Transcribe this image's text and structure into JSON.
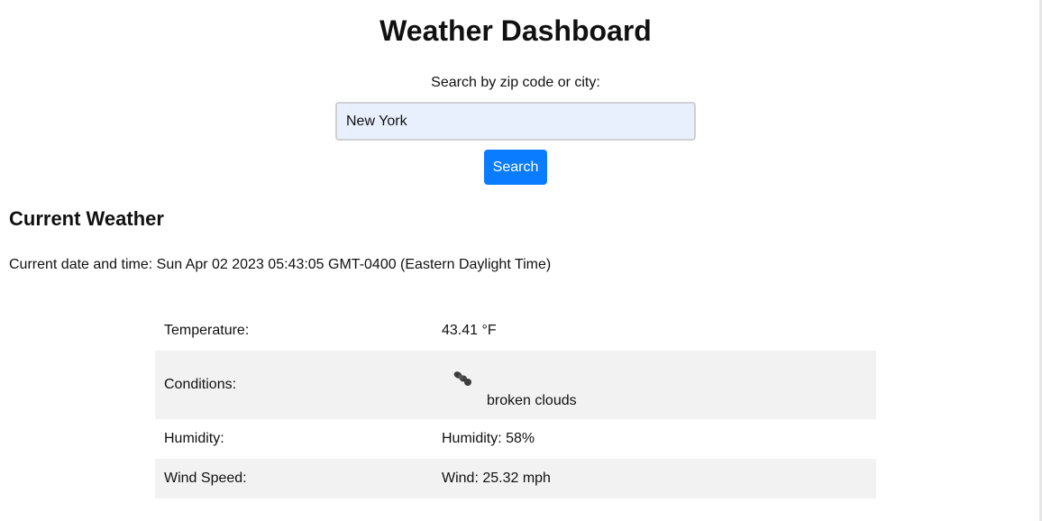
{
  "header": {
    "title": "Weather Dashboard"
  },
  "search": {
    "label": "Search by zip code or city:",
    "value": "New York",
    "button_label": "Search"
  },
  "current": {
    "heading": "Current Weather",
    "datetime": "Current date and time: Sun Apr 02 2023 05:43:05 GMT-0400 (Eastern Daylight Time)"
  },
  "weather": {
    "rows": [
      {
        "label": "Temperature:",
        "value": "43.41 °F"
      },
      {
        "label": "Conditions:",
        "value": "broken clouds",
        "icon": "broken-clouds-icon"
      },
      {
        "label": "Humidity:",
        "value": "Humidity: 58%"
      },
      {
        "label": "Wind Speed:",
        "value": "Wind: 25.32 mph"
      }
    ]
  },
  "colors": {
    "accent": "#0a7cff",
    "input_background": "#e8f0fd",
    "stripe_row": "#f2f2f2"
  }
}
